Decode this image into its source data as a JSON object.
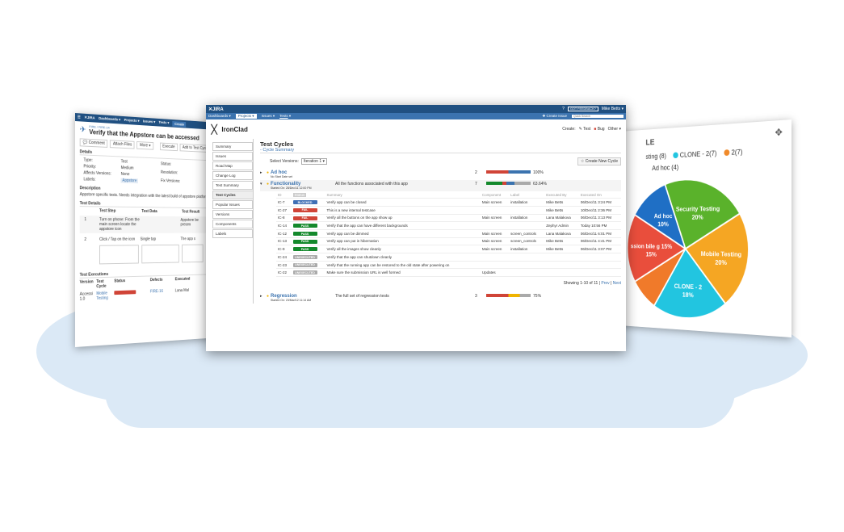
{
  "left_panel": {
    "nav": {
      "dashboards": "Dashboards ▾",
      "projects": "Projects ▾",
      "issues": "Issues ▾",
      "tests": "Tests ▾",
      "create": "Create"
    },
    "breadcrumb": "FIRE / FIRE-14",
    "title": "Verify that the Appstore can be accessed",
    "buttons": {
      "comment": "Comment",
      "attach": "Attach Files",
      "more": "More ▾",
      "execute": "Execute",
      "add_cycle": "Add to Test Cycle(s)"
    },
    "details_heading": "Details",
    "details": [
      {
        "k": "Type:",
        "v": "Test"
      },
      {
        "k": "Priority:",
        "v": "Medium"
      },
      {
        "k": "Affects Versions:",
        "v": "None"
      },
      {
        "k": "Labels:",
        "v": "Appstore"
      }
    ],
    "details_right": [
      {
        "k": "Status:"
      },
      {
        "k": "Resolution:"
      },
      {
        "k": "Fix Versions:"
      }
    ],
    "description_heading": "Description",
    "description": "Appstore specific tests. Needs integration with the latest build of appstore platform",
    "test_details_heading": "Test Details",
    "test_cols": [
      "Test Step",
      "Test Data",
      "Test Result"
    ],
    "steps": [
      {
        "n": "1",
        "step": "Turn on phone: From the main screen locate the appstore icon",
        "data": "",
        "result": "Appstore be presen"
      },
      {
        "n": "2",
        "step": "Click / Tap on the icon",
        "data": "Single tap",
        "result": "The app s"
      }
    ],
    "executions_heading": "Test Executions",
    "exec_cols": [
      "Version",
      "Test Cycle",
      "Status",
      "Defects",
      "Executed"
    ],
    "exec_row": {
      "version": "Accessi 1.0",
      "cycle": "Mobile Testing",
      "defects": "FIRE-16",
      "executed": "Lana Mal"
    }
  },
  "main": {
    "topbar": {
      "logo": "JIRA",
      "feedback": "GOT FEEDBACK?",
      "user": "Mike Betts ▾"
    },
    "nav": {
      "dashboards": "Dashboards",
      "projects": "Projects",
      "issues": "Issues",
      "tests": "Tests",
      "create_issue": "Create Issue",
      "search_placeholder": "Quick Search"
    },
    "project": "IronClad",
    "create_links": {
      "create": "Create:",
      "test": "Test",
      "bug": "Bug",
      "other": "Other ▾"
    },
    "sidebar": [
      "Summary",
      "Issues",
      "Road Map",
      "Change Log",
      "Test Summary",
      "Test Cycles",
      "Popular Issues",
      "Versions",
      "Components",
      "Labels"
    ],
    "page_title": "Test Cycles",
    "cycle_summary": "Cycle Summary",
    "select_versions_label": "Select Versions:",
    "select_versions_value": "Iteration 1",
    "create_cycle": "Create New Cycle",
    "cycles": [
      {
        "name": "Ad hoc",
        "started": "No Start Date set",
        "count": "2",
        "percent": "100%"
      },
      {
        "name": "Functionality",
        "started": "Started On: 28/Dec/11 12:00 PM",
        "desc": "All the functions associated with this app",
        "count": "7",
        "percent": "63.64%"
      },
      {
        "name": "Regression",
        "started": "Started On: 23/Mar/12 11:14 AM",
        "desc": "The full set of regression tests",
        "count": "3",
        "percent": "75%"
      }
    ],
    "exec_cols": [
      "ID",
      "Status",
      "Summary",
      "Component",
      "Label",
      "Executed By",
      "Executed On"
    ],
    "executions": [
      {
        "id": "IC-7",
        "status": "BLOCKED",
        "cls": "t-blocked",
        "summary": "Verify app can be closed",
        "component": "Main screen",
        "label": "installation",
        "by": "Mike Betts",
        "on": "06/Dec/11 3:24 PM"
      },
      {
        "id": "IC-27",
        "status": "FAIL",
        "cls": "t-fail",
        "summary": "This is a new internal testcase",
        "component": "",
        "label": "",
        "by": "Mike Betts",
        "on": "10/Dec/11 2:36 PM"
      },
      {
        "id": "IC-8",
        "status": "FAIL",
        "cls": "t-fail",
        "summary": "Verify all the buttons on the app show up",
        "component": "Main screen",
        "label": "installation",
        "by": "Lana Malakova",
        "on": "06/Dec/11 3:13 PM"
      },
      {
        "id": "IC-14",
        "status": "PASS",
        "cls": "t-pass",
        "summary": "Verify that the app can have different backgrounds",
        "component": "",
        "label": "",
        "by": "Zephyr Admin",
        "on": "Today 10:56 PM"
      },
      {
        "id": "IC-12",
        "status": "PASS",
        "cls": "t-pass",
        "summary": "Verify app can be dimmed",
        "component": "Main screen",
        "label": "screen_controls",
        "by": "Lana Malakova",
        "on": "06/Dec/11 6:01 PM"
      },
      {
        "id": "IC-13",
        "status": "PASS",
        "cls": "t-pass",
        "summary": "Verify app can put in hibernation",
        "component": "Main screen",
        "label": "screen_controls",
        "by": "Mike Betts",
        "on": "06/Dec/11 4:41 PM"
      },
      {
        "id": "IC-9",
        "status": "PASS",
        "cls": "t-pass",
        "summary": "Verify all the images show cleanly",
        "component": "Main screen",
        "label": "installation",
        "by": "Mike Betts",
        "on": "06/Dec/11 3:07 PM"
      },
      {
        "id": "IC-24",
        "status": "UNEXECUTED",
        "cls": "t-unex",
        "summary": "Verify that the app can shutdown cleanly",
        "component": "",
        "label": "",
        "by": "",
        "on": ""
      },
      {
        "id": "IC-23",
        "status": "UNEXECUTED",
        "cls": "t-unex",
        "summary": "Verify that the running app can be restored to the old state after powering on",
        "component": "",
        "label": "",
        "by": "",
        "on": ""
      },
      {
        "id": "IC-22",
        "status": "UNEXECUTED",
        "cls": "t-unex",
        "summary": "Make sure the submission URL is well formed",
        "component": "Updates",
        "label": "",
        "by": "",
        "on": ""
      }
    ],
    "showing": "Showing 1-10 of 11",
    "prev": "Prev",
    "next": "Next"
  },
  "right_panel": {
    "partial_title": "LE",
    "legend": [
      {
        "label": "sting (8)",
        "color": ""
      },
      {
        "label": "CLONE - 2(7)",
        "color": "#22c5e0"
      },
      {
        "label": "2(7)",
        "color": "#f08a2a"
      },
      {
        "label": "Ad hoc (4)",
        "color": ""
      }
    ],
    "chart_data": {
      "type": "pie",
      "slices": [
        {
          "label": "Security Testing",
          "value": 20,
          "color": "#5ab22b"
        },
        {
          "label": "Mobile Testing",
          "value": 20,
          "color": "#f5a623"
        },
        {
          "label": "CLONE - 2",
          "value": 18,
          "color": "#22c5e0"
        },
        {
          "label": "",
          "value": 7,
          "color": "#f07a2a"
        },
        {
          "label": "ssion bile g 15%",
          "value": 15,
          "color": "#e94e3c"
        },
        {
          "label": "Ad hoc",
          "value": 10,
          "color": "#1f6fc5"
        }
      ]
    }
  }
}
